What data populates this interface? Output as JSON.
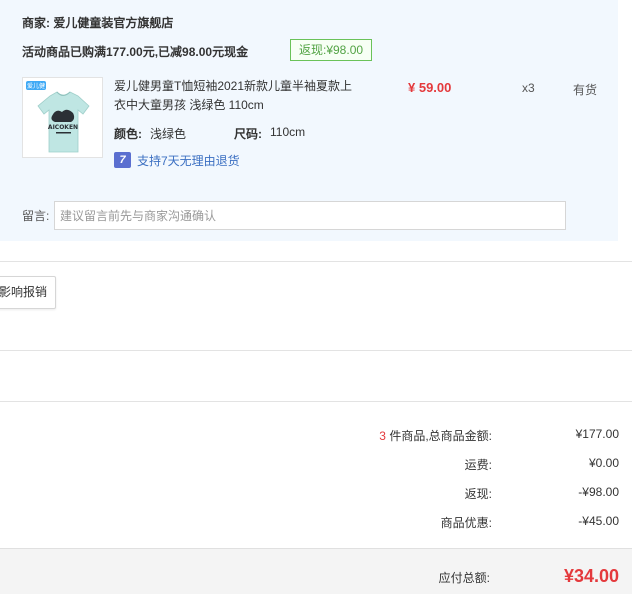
{
  "shop": {
    "label": "商家:",
    "name": "爱儿健童装官方旗舰店"
  },
  "promo": {
    "text": "活动商品已购满177.00元,已减98.00元现金",
    "cashback_tag": "返现:¥98.00"
  },
  "product": {
    "brand_mark": "爱儿健",
    "shirt_print": "AICOKEN",
    "title": "爱儿健男童T恤短袖2021新款儿童半袖夏款上衣中大童男孩 浅绿色 110cm",
    "price": "¥ 59.00",
    "quantity": "x3",
    "stock": "有货",
    "color_label": "颜色:",
    "color_value": "浅绿色",
    "size_label": "尺码:",
    "size_value": "110cm",
    "return_icon": "7",
    "return_policy": "支持7天无理由退货"
  },
  "message": {
    "label": "留言:",
    "placeholder": "建议留言前先与商家沟通确认"
  },
  "invoice_button": "影响报销",
  "summary": {
    "item_count": "3",
    "items_label": " 件商品,总商品金额:",
    "items_total": "¥177.00",
    "shipping_label": "运费:",
    "shipping_value": "¥0.00",
    "cashback_label": "返现:",
    "cashback_value": "-¥98.00",
    "discount_label": "商品优惠:",
    "discount_value": "-¥45.00"
  },
  "total": {
    "label": "应付总额:",
    "value": "¥34.00"
  },
  "colors": {
    "accent_red": "#e4393c",
    "cashback_green": "#52a344",
    "panel_bg": "#f2f8fe",
    "link_blue": "#3b6fc2"
  },
  "icons": {
    "return": "seven-day-return-icon"
  }
}
